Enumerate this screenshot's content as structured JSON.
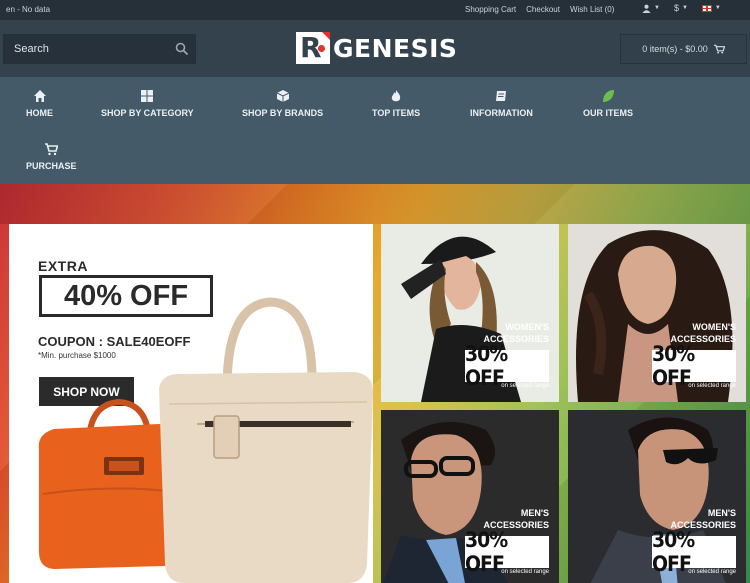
{
  "topbar": {
    "language": "en - No data",
    "links": [
      "Shopping Cart",
      "Checkout",
      "Wish List (0)"
    ],
    "currency": "$"
  },
  "header": {
    "search_placeholder": "Search",
    "logo_text": "GENESIS",
    "logo_mark": "R",
    "cart_summary": "0 item(s) - $0.00"
  },
  "nav": {
    "items": [
      {
        "label": "HOME",
        "icon": "home-icon"
      },
      {
        "label": "SHOP BY CATEGORY",
        "icon": "grid-icon"
      },
      {
        "label": "SHOP BY BRANDS",
        "icon": "cube-icon"
      },
      {
        "label": "TOP ITEMS",
        "icon": "fire-icon"
      },
      {
        "label": "INFORMATION",
        "icon": "book-icon"
      },
      {
        "label": "OUR ITEMS",
        "icon": "leaf-icon"
      },
      {
        "label": "PURCHASE",
        "icon": "cart-icon"
      }
    ]
  },
  "promo": {
    "extra": "EXTRA",
    "discount": "40% OFF",
    "coupon": "COUPON : SALE40EOFF",
    "min_purchase": "*Min. purchase $1000",
    "cta": "SHOP NOW"
  },
  "tiles": [
    {
      "line1": "WOMEN'S",
      "line2": "ACCESSORIES",
      "offer": "30% OFF",
      "note": "on selected range"
    },
    {
      "line1": "WOMEN'S",
      "line2": "ACCESSORIES",
      "offer": "30% OFF",
      "note": "on selected range"
    },
    {
      "line1": "MEN'S",
      "line2": "ACCESSORIES",
      "offer": "30% OFF",
      "note": "on selected range"
    },
    {
      "line1": "MEN'S",
      "line2": "ACCESSORIES",
      "offer": "30% OFF",
      "note": "on selected range"
    }
  ],
  "colors": {
    "topbar": "#263039",
    "header": "#34424e",
    "nav": "#445a68",
    "logo_accent": "#e1342c",
    "leaf_icon": "#6cbf4a"
  }
}
